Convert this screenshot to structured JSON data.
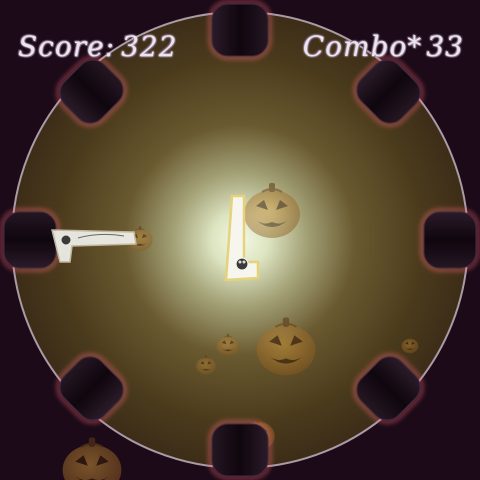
{
  "hud": {
    "score_label": "Score:",
    "score_value": "322",
    "combo_label": "Combo*",
    "combo_value": "33"
  },
  "colors": {
    "background": "#1c0a18",
    "arena_outer": "#3a2a14",
    "arena_glow": "#e8f0d0",
    "arena_rim": "#9a8f94",
    "hole_fill": "#150a14",
    "hole_edge": "#ff6a7a",
    "pumpkin": "#b07a2a",
    "bat_white": "#f2f2ee",
    "bat_outline": "#e6d27a"
  },
  "holes": 8,
  "paddles": [
    "left-paddle",
    "center-paddle"
  ],
  "decorations": [
    "pumpkin-face-icon"
  ]
}
